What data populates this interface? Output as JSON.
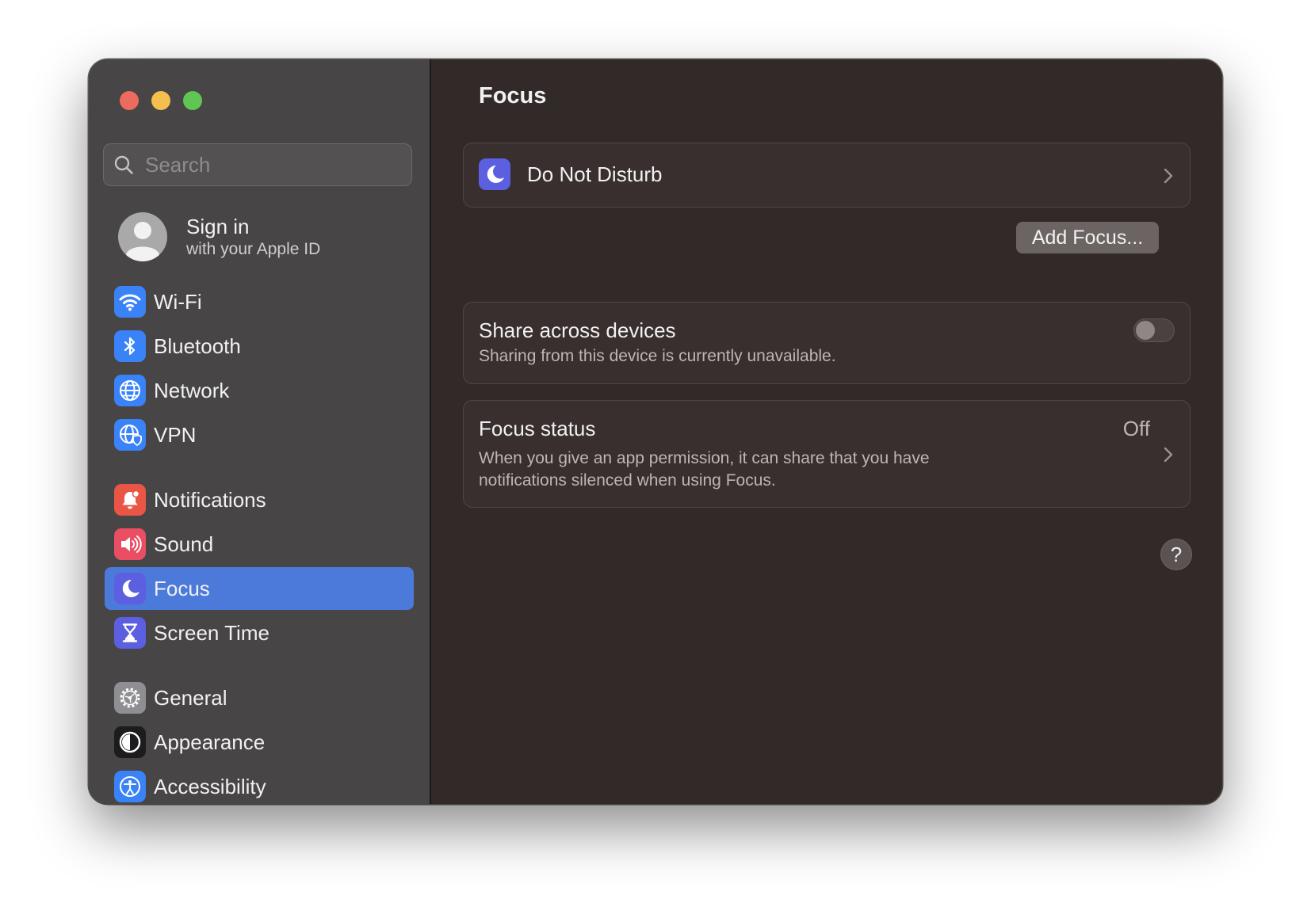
{
  "window": {
    "title": "Focus"
  },
  "search": {
    "placeholder": "Search"
  },
  "account": {
    "title": "Sign in",
    "subtitle": "with your Apple ID"
  },
  "sidebar": {
    "items": [
      {
        "label": "Wi-Fi",
        "icon": "wifi-icon",
        "color": "#3a82f7"
      },
      {
        "label": "Bluetooth",
        "icon": "bluetooth-icon",
        "color": "#3a82f7"
      },
      {
        "label": "Network",
        "icon": "globe-icon",
        "color": "#3a82f7"
      },
      {
        "label": "VPN",
        "icon": "vpn-globe-icon",
        "color": "#3a82f7"
      },
      {
        "label": "Notifications",
        "icon": "bell-icon",
        "color": "#eb5545"
      },
      {
        "label": "Sound",
        "icon": "speaker-icon",
        "color": "#ea4e63"
      },
      {
        "label": "Focus",
        "icon": "moon-icon",
        "color": "#5b5fe0",
        "selected": true
      },
      {
        "label": "Screen Time",
        "icon": "hourglass-icon",
        "color": "#5b5fe0"
      },
      {
        "label": "General",
        "icon": "gear-icon",
        "color": "#8e8e93"
      },
      {
        "label": "Appearance",
        "icon": "appearance-icon",
        "color": "#1c1c1e"
      },
      {
        "label": "Accessibility",
        "icon": "accessibility-icon",
        "color": "#3a82f7"
      }
    ]
  },
  "main": {
    "title": "Focus",
    "focus_modes": [
      {
        "label": "Do Not Disturb",
        "icon": "moon-icon"
      }
    ],
    "add_focus_label": "Add Focus...",
    "share": {
      "title": "Share across devices",
      "subtitle": "Sharing from this device is currently unavailable.",
      "enabled": false
    },
    "status": {
      "title": "Focus status",
      "value": "Off",
      "description_line1": "When you give an app permission, it can share that you have",
      "description_line2": "notifications silenced when using Focus."
    },
    "help_label": "?"
  },
  "colors": {
    "accent": "#4c7adb"
  }
}
